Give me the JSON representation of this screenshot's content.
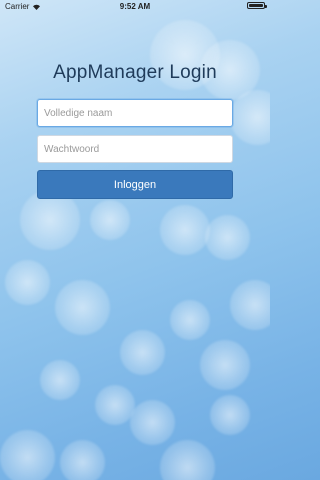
{
  "status_bar": {
    "carrier": "Carrier",
    "time": "9:52 AM"
  },
  "login": {
    "title": "AppManager Login",
    "name_placeholder": "Volledige naam",
    "password_placeholder": "Wachtwoord",
    "submit_label": "Inloggen"
  },
  "colors": {
    "accent": "#3a79bc",
    "title": "#1f3b5a"
  }
}
